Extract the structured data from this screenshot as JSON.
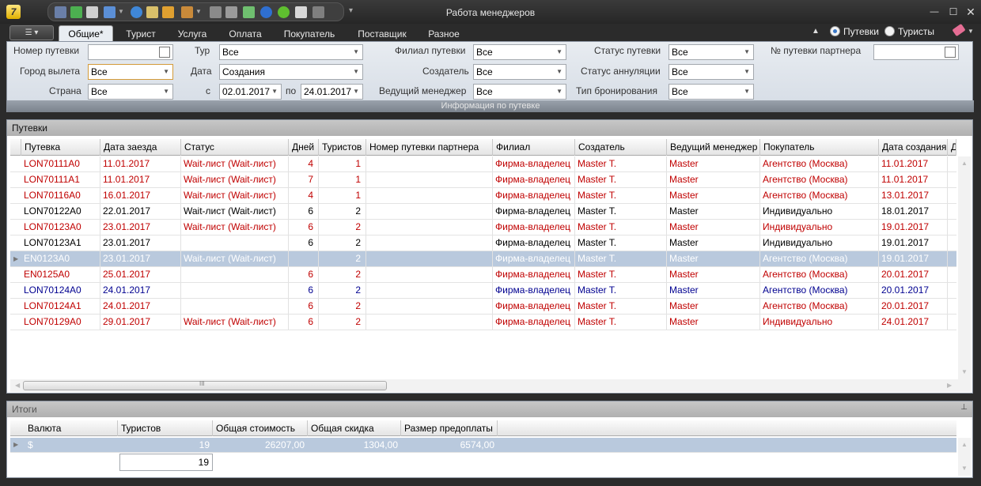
{
  "window": {
    "title": "Работа менеджеров",
    "app_logo": "7",
    "min": "—",
    "max": "☐",
    "close": "✕"
  },
  "ribbon": {
    "menu_label": "☰ ▾",
    "tabs": [
      "Общие*",
      "Турист",
      "Услуга",
      "Оплата",
      "Покупатель",
      "Поставщик",
      "Разное"
    ],
    "active_tab": "Общие*",
    "radio_options": [
      "Путевки",
      "Туристы"
    ],
    "selected_radio": "Путевки"
  },
  "filters": {
    "caption": "Информация по путевке",
    "labels": {
      "voucher_no": "Номер путевки",
      "city": "Город вылета",
      "country": "Страна",
      "tour": "Тур",
      "date": "Дата",
      "from": "с",
      "to": "по",
      "branch": "Филиал путевки",
      "creator": "Создатель",
      "lead_manager": "Ведущий менеджер",
      "status": "Статус путевки",
      "cancel_status": "Статус аннуляции",
      "booking_type": "Тип бронирования",
      "partner_no": "№ путевки партнера"
    },
    "values": {
      "voucher_no": "",
      "city": "Все",
      "country": "Все",
      "tour": "Все",
      "date": "Создания",
      "from": "02.01.2017",
      "to": "24.01.2017",
      "branch": "Все",
      "creator": "Все",
      "lead_manager": "Все",
      "status": "Все",
      "cancel_status": "Все",
      "booking_type": "Все",
      "partner_no": ""
    }
  },
  "vouchers": {
    "panel_title": "Путевки",
    "columns": [
      "Путевка",
      "Дата заезда",
      "Статус",
      "Дней",
      "Туристов",
      "Номер путевки партнера",
      "Филиал",
      "Создатель",
      "Ведущий менеджер",
      "Покупатель",
      "Дата создания",
      "Д"
    ],
    "rows": [
      {
        "color": "red",
        "cells": [
          "LON70111A0",
          "11.01.2017",
          "Wait-лист (Wait-лист)",
          "4",
          "1",
          "",
          "Фирма-владелец",
          "Master T.",
          "Master",
          "Агентство (Москва)",
          "11.01.2017"
        ]
      },
      {
        "color": "red",
        "cells": [
          "LON70111A1",
          "11.01.2017",
          "Wait-лист (Wait-лист)",
          "7",
          "1",
          "",
          "Фирма-владелец",
          "Master T.",
          "Master",
          "Агентство (Москва)",
          "11.01.2017"
        ]
      },
      {
        "color": "red",
        "cells": [
          "LON70116A0",
          "16.01.2017",
          "Wait-лист (Wait-лист)",
          "4",
          "1",
          "",
          "Фирма-владелец",
          "Master T.",
          "Master",
          "Агентство (Москва)",
          "13.01.2017"
        ]
      },
      {
        "color": "black",
        "cells": [
          "LON70122A0",
          "22.01.2017",
          "Wait-лист (Wait-лист)",
          "6",
          "2",
          "",
          "Фирма-владелец",
          "Master T.",
          "Master",
          "Индивидуально",
          "18.01.2017"
        ]
      },
      {
        "color": "red",
        "cells": [
          "LON70123A0",
          "23.01.2017",
          "Wait-лист (Wait-лист)",
          "6",
          "2",
          "",
          "Фирма-владелец",
          "Master T.",
          "Master",
          "Индивидуально",
          "19.01.2017"
        ]
      },
      {
        "color": "black",
        "cells": [
          "LON70123A1",
          "23.01.2017",
          "",
          "6",
          "2",
          "",
          "Фирма-владелец",
          "Master T.",
          "Master",
          "Индивидуально",
          "19.01.2017"
        ]
      },
      {
        "color": "gray",
        "selected": true,
        "cells": [
          "EN0123A0",
          "23.01.2017",
          "Wait-лист (Wait-лист)",
          "",
          "2",
          "",
          "Фирма-владелец",
          "Master T.",
          "Master",
          "Агентство (Москва)",
          "19.01.2017"
        ]
      },
      {
        "color": "red",
        "cells": [
          "EN0125A0",
          "25.01.2017",
          "",
          "6",
          "2",
          "",
          "Фирма-владелец",
          "Master T.",
          "Master",
          "Агентство (Москва)",
          "20.01.2017"
        ]
      },
      {
        "color": "blue",
        "cells": [
          "LON70124A0",
          "24.01.2017",
          "",
          "6",
          "2",
          "",
          "Фирма-владелец",
          "Master T.",
          "Master",
          "Агентство (Москва)",
          "20.01.2017"
        ]
      },
      {
        "color": "red",
        "cells": [
          "LON70124A1",
          "24.01.2017",
          "",
          "6",
          "2",
          "",
          "Фирма-владелец",
          "Master T.",
          "Master",
          "Агентство (Москва)",
          "20.01.2017"
        ]
      },
      {
        "color": "red",
        "cells": [
          "LON70129A0",
          "29.01.2017",
          "Wait-лист (Wait-лист)",
          "6",
          "2",
          "",
          "Фирма-владелец",
          "Master T.",
          "Master",
          "Индивидуально",
          "24.01.2017"
        ]
      }
    ],
    "scroll_grip": "III"
  },
  "totals": {
    "panel_title": "Итоги",
    "pin_icon": "📌",
    "columns": [
      "Валюта",
      "Туристов",
      "Общая стоимость",
      "Общая скидка",
      "Размер предоплаты"
    ],
    "row": [
      "$",
      "19",
      "26207,00",
      "1304,00",
      "6574,00"
    ],
    "tourists_sum": "19"
  }
}
